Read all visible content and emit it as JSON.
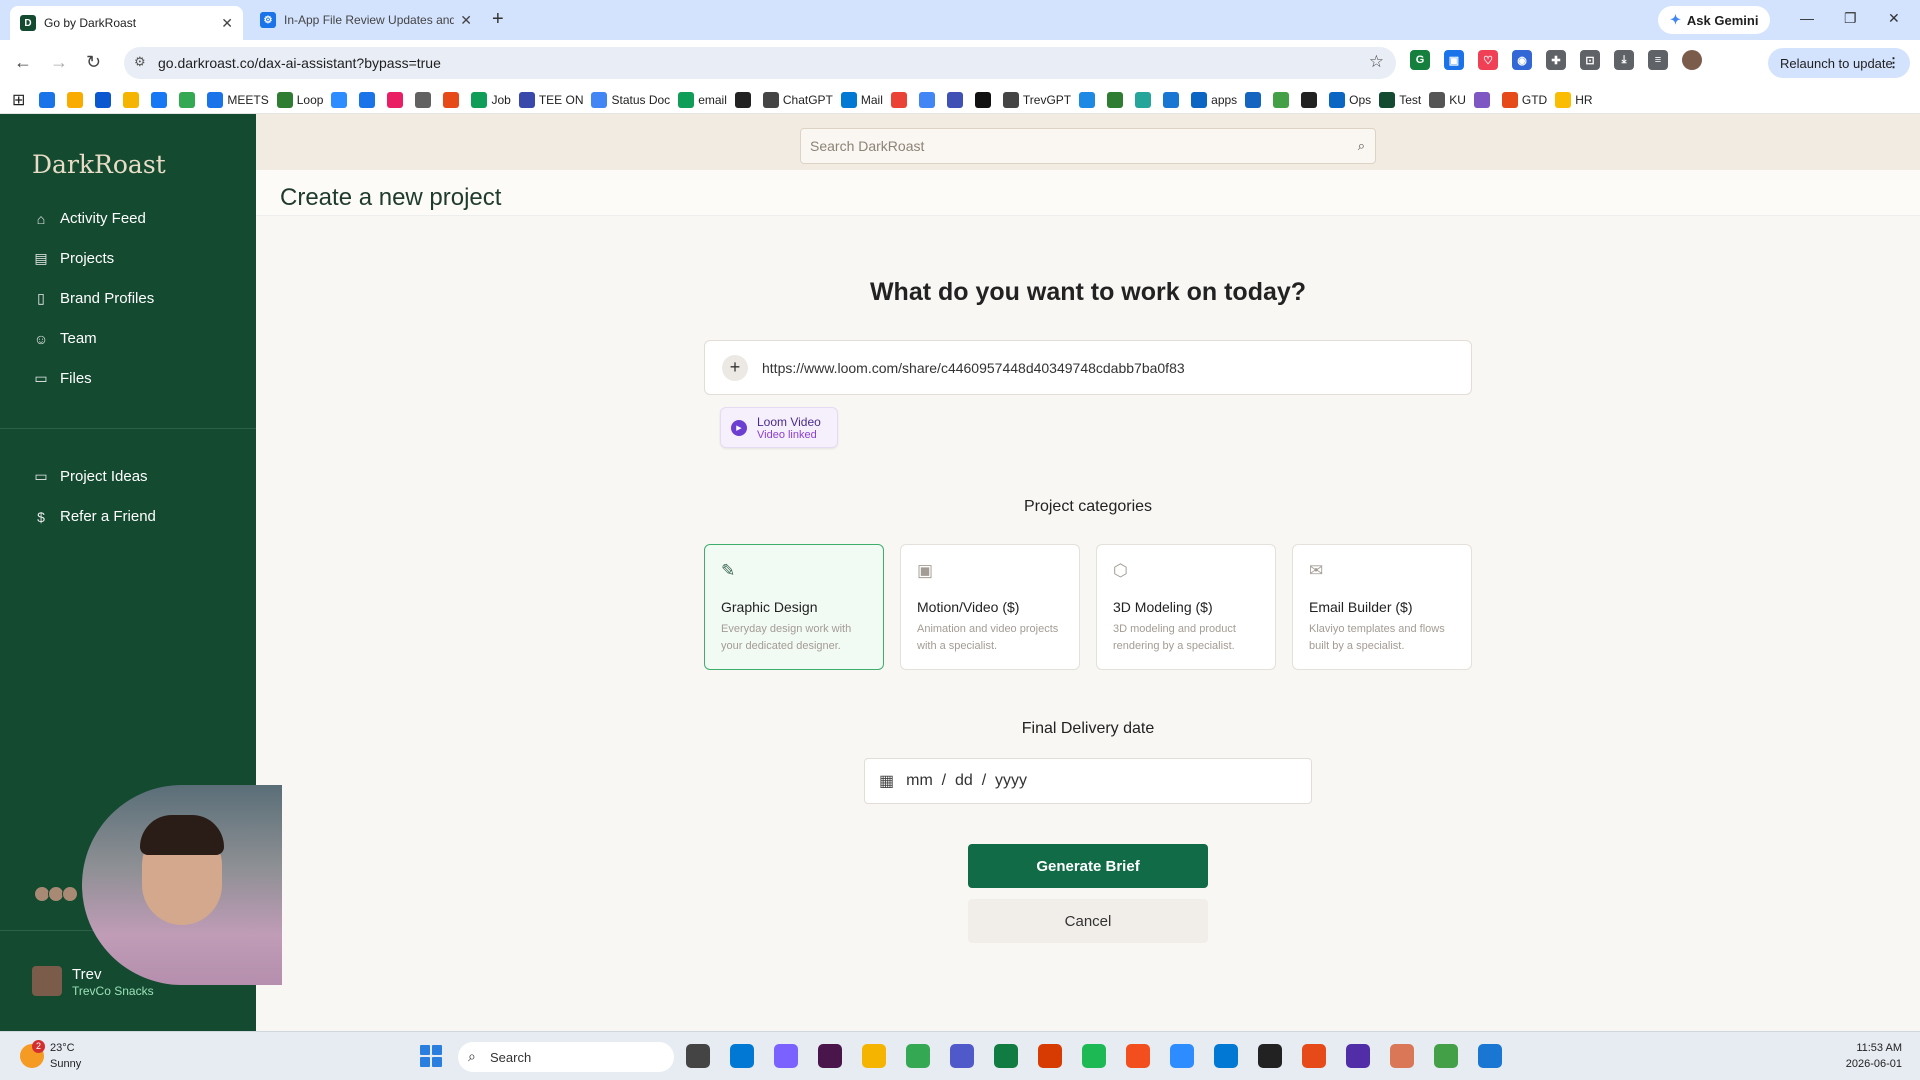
{
  "browser": {
    "tabs": [
      {
        "title": "Go by DarkRoast",
        "favicon": "D",
        "active": true
      },
      {
        "title": "In-App File Review Updates and",
        "favicon": "",
        "active": false
      }
    ],
    "ask_gemini": "Ask Gemini",
    "url": "go.darkroast.co/dax-ai-assistant?bypass=true",
    "relaunch": "Relaunch to update",
    "bookmarks": [
      {
        "label": "",
        "color": "#1a73e8"
      },
      {
        "label": "",
        "color": "#f9ab00"
      },
      {
        "label": "",
        "color": "#0b57d0"
      },
      {
        "label": "",
        "color": "#f4b400"
      },
      {
        "label": "",
        "color": "#1877f2"
      },
      {
        "label": "",
        "color": "#34a853"
      },
      {
        "label": "MEETS",
        "color": "#1a73e8"
      },
      {
        "label": "Loop",
        "color": "#2e7d32"
      },
      {
        "label": "",
        "color": "#2d8cff"
      },
      {
        "label": "",
        "color": "#1a73e8"
      },
      {
        "label": "",
        "color": "#e91e63"
      },
      {
        "label": "",
        "color": "#616161"
      },
      {
        "label": "",
        "color": "#e64a19"
      },
      {
        "label": "Job",
        "color": "#0f9d58"
      },
      {
        "label": "TEE ON",
        "color": "#3949ab"
      },
      {
        "label": "Status Doc",
        "color": "#4285f4"
      },
      {
        "label": "email",
        "color": "#0f9d58"
      },
      {
        "label": "",
        "color": "#222222"
      },
      {
        "label": "ChatGPT",
        "color": "#444444"
      },
      {
        "label": "Mail",
        "color": "#0078d4"
      },
      {
        "label": "",
        "color": "#ea4335"
      },
      {
        "label": "",
        "color": "#4285f4"
      },
      {
        "label": "",
        "color": "#3f51b5"
      },
      {
        "label": "",
        "color": "#111111"
      },
      {
        "label": "TrevGPT",
        "color": "#444444"
      },
      {
        "label": "",
        "color": "#1e88e5"
      },
      {
        "label": "",
        "color": "#2e7d32"
      },
      {
        "label": "",
        "color": "#26a69a"
      },
      {
        "label": "",
        "color": "#1976d2"
      },
      {
        "label": "apps",
        "color": "#0a66c2"
      },
      {
        "label": "",
        "color": "#1565c0"
      },
      {
        "label": "",
        "color": "#43a047"
      },
      {
        "label": "",
        "color": "#222222"
      },
      {
        "label": "Ops",
        "color": "#0a66c2"
      },
      {
        "label": "Test",
        "color": "#134a30"
      },
      {
        "label": "KU",
        "color": "#555555"
      },
      {
        "label": "",
        "color": "#7e57c2"
      },
      {
        "label": "GTD",
        "color": "#e64a19"
      },
      {
        "label": "HR",
        "color": "#fbbc04"
      }
    ]
  },
  "sidebar": {
    "logo": "DarkRoast",
    "items": [
      {
        "label": "Activity Feed",
        "icon": "home-icon"
      },
      {
        "label": "Projects",
        "icon": "clipboard-icon"
      },
      {
        "label": "Brand Profiles",
        "icon": "book-icon"
      },
      {
        "label": "Team",
        "icon": "users-icon"
      },
      {
        "label": "Files",
        "icon": "folder-icon"
      }
    ],
    "secondary": [
      {
        "label": "Project Ideas",
        "icon": "folder-icon"
      },
      {
        "label": "Refer a Friend",
        "icon": "dollar-icon"
      }
    ],
    "user": {
      "name": "Trev",
      "company": "TrevCo Snacks"
    }
  },
  "search": {
    "placeholder": "Search DarkRoast"
  },
  "page": {
    "title": "Create a new project",
    "question": "What do you want to work on today?",
    "url_value": "https://www.loom.com/share/c4460957448d40349748cdabb7ba0f83",
    "loom": {
      "title": "Loom Video",
      "subtitle": "Video linked"
    },
    "categories_title": "Project categories",
    "categories": [
      {
        "name": "Graphic Design",
        "desc": "Everyday design work with your dedicated designer.",
        "icon": "pen-tool-icon",
        "selected": true
      },
      {
        "name": "Motion/Video ($)",
        "desc": "Animation and video projects with a specialist.",
        "icon": "monitor-play-icon",
        "selected": false
      },
      {
        "name": "3D Modeling ($)",
        "desc": "3D modeling and product rendering by a specialist.",
        "icon": "cube-icon",
        "selected": false
      },
      {
        "name": "Email Builder ($)",
        "desc": "Klaviyo templates and flows built by a specialist.",
        "icon": "mail-icon",
        "selected": false
      }
    ],
    "date_title": "Final Delivery date",
    "date_placeholder": "mm  /  dd  /  yyyy",
    "generate": "Generate Brief",
    "cancel": "Cancel"
  },
  "taskbar": {
    "weather_temp": "23°C",
    "weather_cond": "Sunny",
    "weather_badge": "2",
    "search": "Search",
    "time": "11:53 AM",
    "date": "2026-06-01",
    "apps": [
      {
        "name": "task-view",
        "color": "#444444"
      },
      {
        "name": "widgets",
        "color": "#0078d4"
      },
      {
        "name": "copilot",
        "color": "#7b61ff"
      },
      {
        "name": "slack",
        "color": "#4a154b"
      },
      {
        "name": "file-explorer",
        "color": "#f4b400"
      },
      {
        "name": "chrome",
        "color": "#34a853"
      },
      {
        "name": "teams",
        "color": "#5059c9"
      },
      {
        "name": "excel",
        "color": "#107c41"
      },
      {
        "name": "office",
        "color": "#d83b01"
      },
      {
        "name": "spotify",
        "color": "#1db954"
      },
      {
        "name": "figma",
        "color": "#f24e1e"
      },
      {
        "name": "zoom",
        "color": "#2d8cff"
      },
      {
        "name": "outlook",
        "color": "#0078d4"
      },
      {
        "name": "app",
        "color": "#222222"
      },
      {
        "name": "app2",
        "color": "#e64a19"
      },
      {
        "name": "app3",
        "color": "#512da8"
      },
      {
        "name": "claude",
        "color": "#d97757"
      },
      {
        "name": "app4",
        "color": "#43a047"
      },
      {
        "name": "settings",
        "color": "#1976d2"
      }
    ]
  }
}
